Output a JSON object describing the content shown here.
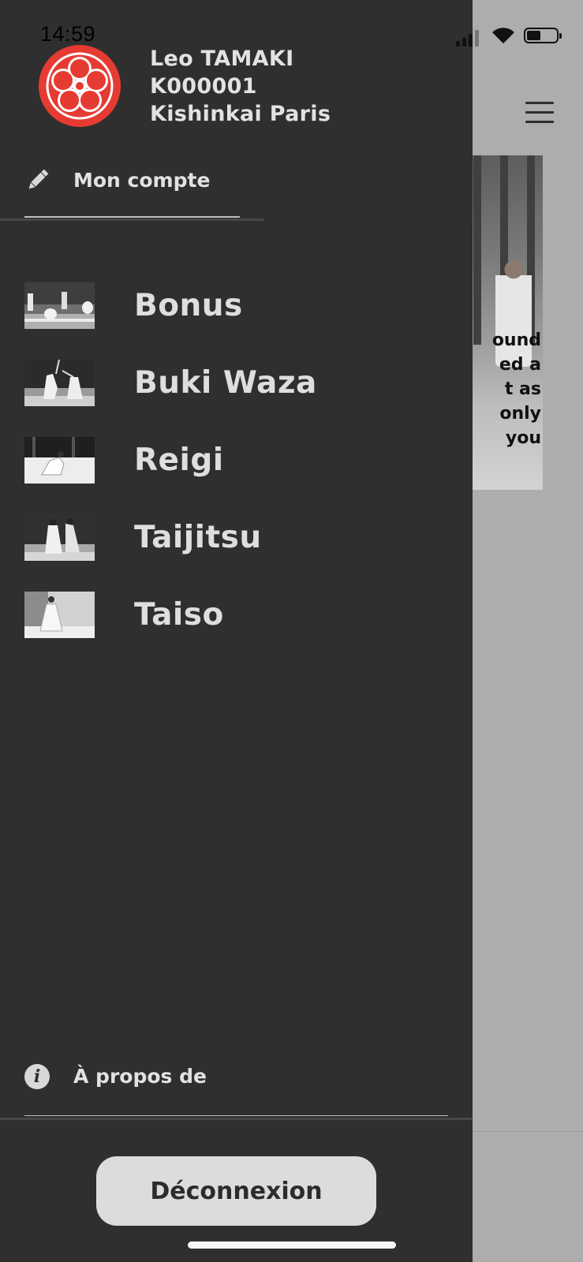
{
  "status_bar": {
    "time": "14:59",
    "icons": [
      "signal-icon",
      "wifi-icon",
      "battery-icon"
    ]
  },
  "background_screen": {
    "menu_icon": "hamburger-menu-icon",
    "photo_text_lines": [
      "ound",
      "ed a",
      "t as",
      "only",
      "you"
    ]
  },
  "drawer": {
    "logo_icon": "club-crest-flower-icon",
    "logo_color": "#e63b32",
    "profile": {
      "name": "Leo TAMAKI",
      "member_id": "K000001",
      "club": "Kishinkai Paris"
    },
    "account": {
      "icon": "pencil-icon",
      "label": "Mon compte"
    },
    "menu_items": [
      {
        "label": "Bonus"
      },
      {
        "label": "Buki Waza"
      },
      {
        "label": "Reigi"
      },
      {
        "label": "Taijitsu"
      },
      {
        "label": "Taiso"
      }
    ],
    "about": {
      "icon": "info-icon",
      "label": "À propos de"
    },
    "logout_label": "Déconnexion"
  },
  "colors": {
    "drawer_bg": "#2f2f2f",
    "text": "#e2e2e2",
    "accent": "#e63b32",
    "button_bg": "#dcdcdc"
  }
}
